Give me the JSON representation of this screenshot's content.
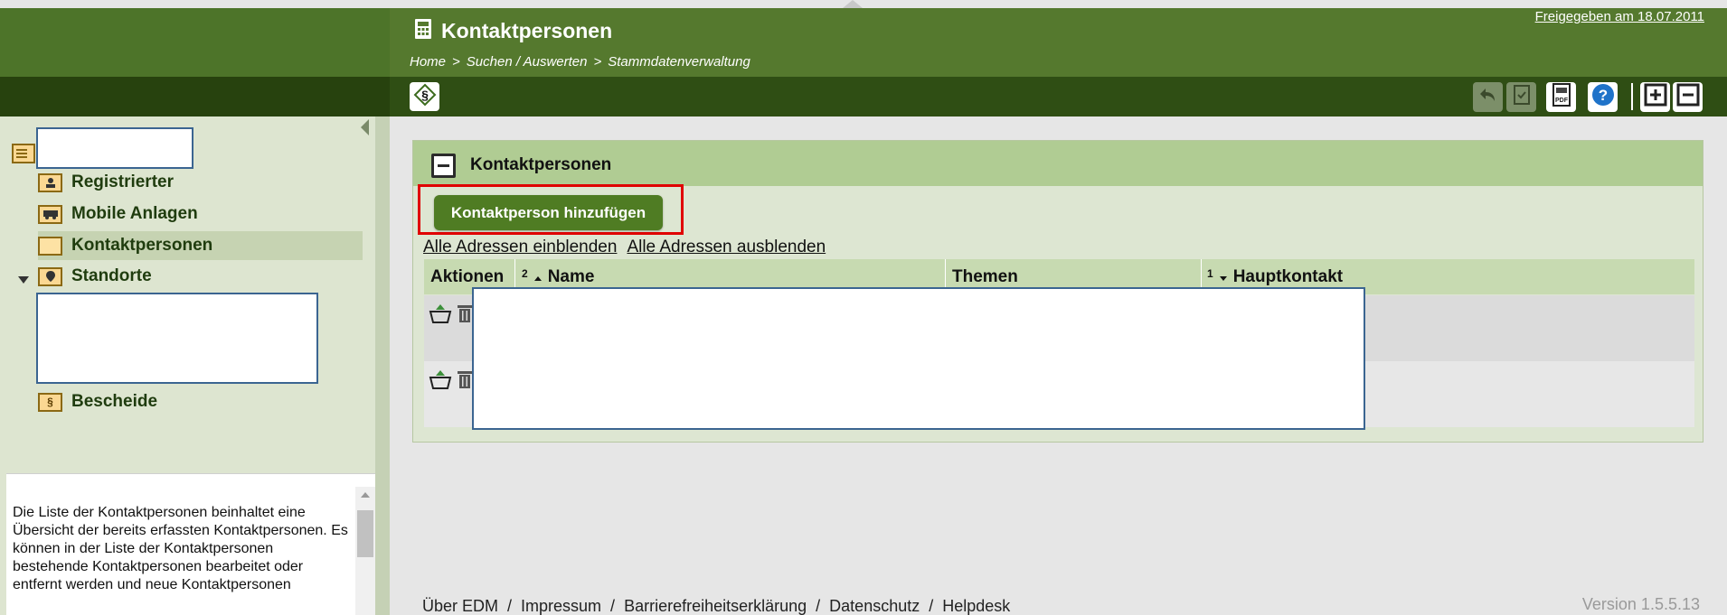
{
  "header": {
    "title": "Kontaktpersonen",
    "breadcrumb": [
      "Home",
      ">",
      "Suchen / Auswerten",
      ">",
      "Stammdatenverwaltung"
    ],
    "released_link": "Freigegeben am 18.07.2011"
  },
  "toolbar": {
    "paragraph_icon": "paragraph-icon",
    "icons": [
      "undo-icon",
      "save-icon",
      "pdf-icon",
      "help-icon",
      "expand-all-icon",
      "collapse-all-icon"
    ]
  },
  "sidebar": {
    "items": [
      {
        "label": "Registrierter",
        "icon": "person-card-icon"
      },
      {
        "label": "Mobile Anlagen",
        "icon": "mobile-plant-icon"
      },
      {
        "label": "Kontaktpersonen",
        "icon": "folder-icon",
        "selected": true
      },
      {
        "label": "Standorte",
        "icon": "location-icon"
      },
      {
        "label": "Bescheide",
        "icon": "paragraph-folder-icon"
      }
    ],
    "help_text": "Die Liste der Kontaktpersonen beinhaltet eine Übersicht der bereits erfassten Kontaktpersonen. Es können in der Liste der Kontaktpersonen bestehende Kontaktpersonen bearbeitet oder entfernt werden und neue Kontaktpersonen"
  },
  "panel": {
    "title": "Kontaktpersonen",
    "add_button": "Kontaktperson hinzufügen",
    "show_all_addresses": "Alle Adressen einblenden",
    "hide_all_addresses": "Alle Adressen ausblenden",
    "columns": {
      "actions": "Aktionen",
      "name_sort": "2",
      "name": "Name",
      "topics": "Themen",
      "main_sort": "1",
      "main_contact": "Hauptkontakt"
    }
  },
  "footer": {
    "links": [
      "Über EDM",
      "/",
      "Impressum",
      "/",
      "Barrierefreiheitserklärung",
      "/",
      "Datenschutz",
      "/",
      "Helpdesk"
    ],
    "version": "Version 1.5.5.13"
  },
  "colors": {
    "header_green": "#55792e",
    "toolbar_dark": "#2f4e14",
    "button_green": "#4f7c23",
    "highlight_red": "#e00000"
  }
}
